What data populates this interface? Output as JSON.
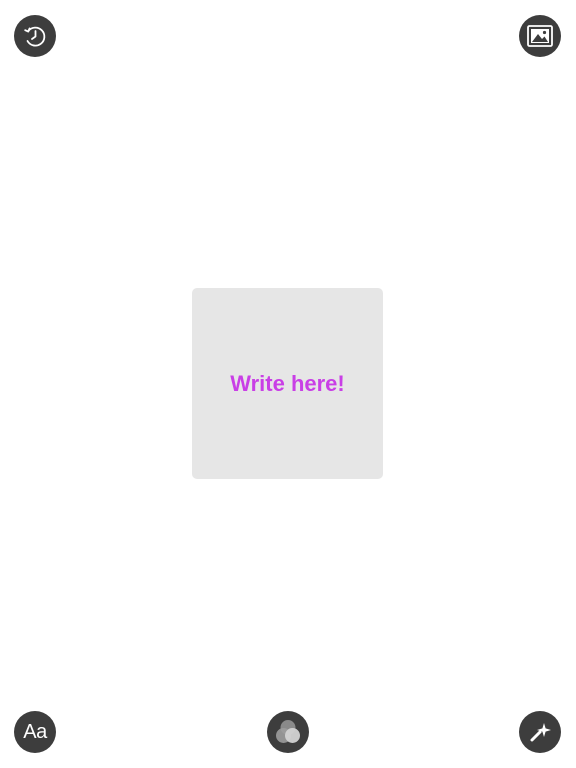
{
  "toolbar_top": {
    "history_icon": "clock-history-icon",
    "image_icon": "image-picture-icon"
  },
  "toolbar_bottom": {
    "font_label": "Aa",
    "color_icon": "color-circles-icon",
    "magic_icon": "magic-wand-sparkle-icon"
  },
  "note": {
    "text": "Write here!",
    "text_color": "#c93fe6",
    "background_color": "#e6e6e6"
  },
  "colors": {
    "button_background": "#3d3d3d",
    "page_background": "#ffffff"
  }
}
